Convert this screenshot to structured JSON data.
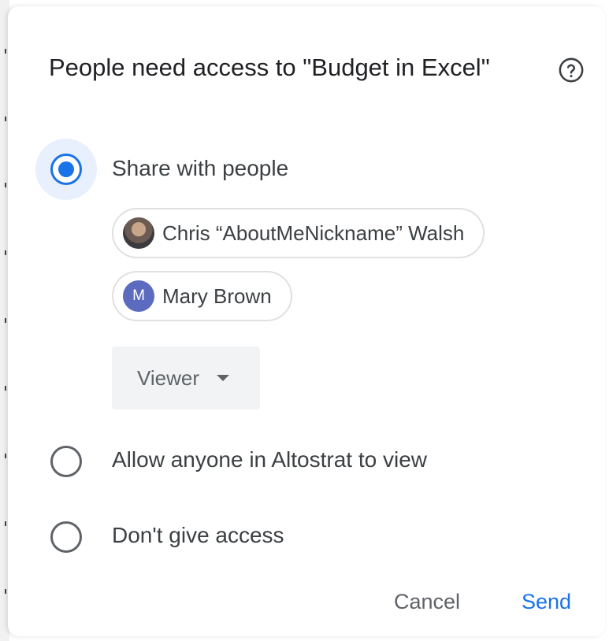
{
  "dialog": {
    "title": "People need access to \"Budget in Excel\"",
    "help_icon": "help-circle-icon"
  },
  "options": [
    {
      "label": "Share with people",
      "checked": true
    },
    {
      "label": "Allow anyone in Altostrat to view",
      "checked": false
    },
    {
      "label": "Don't give access",
      "checked": false
    }
  ],
  "people": [
    {
      "name": "Chris “AboutMeNickname” Walsh",
      "avatar": "photo"
    },
    {
      "name": "Mary Brown",
      "avatar_letter": "M",
      "avatar_color": "#5c6bc0"
    }
  ],
  "role": {
    "selected": "Viewer"
  },
  "actions": {
    "cancel_label": "Cancel",
    "send_label": "Send"
  },
  "colors": {
    "accent": "#1a73e8",
    "text": "#3c4043",
    "muted": "#5f6368"
  }
}
